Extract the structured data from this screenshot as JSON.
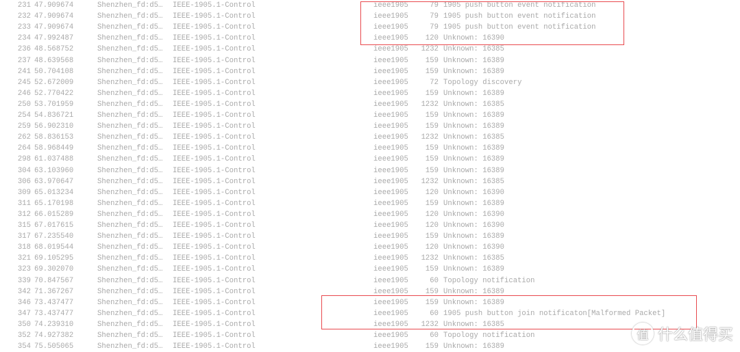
{
  "packet_list": {
    "rows": [
      [
        "231",
        "47.909674",
        "Shenzhen_fd:d5…",
        "IEEE-1905.1-Control",
        "ieee1905",
        "79",
        "1905 push button event notification"
      ],
      [
        "232",
        "47.909674",
        "Shenzhen_fd:d5…",
        "IEEE-1905.1-Control",
        "ieee1905",
        "79",
        "1905 push button event notification"
      ],
      [
        "233",
        "47.909674",
        "Shenzhen_fd:d5…",
        "IEEE-1905.1-Control",
        "ieee1905",
        "79",
        "1905 push button event notification"
      ],
      [
        "234",
        "47.992487",
        "Shenzhen_fd:d5…",
        "IEEE-1905.1-Control",
        "ieee1905",
        "120",
        "Unknown: 16390"
      ],
      [
        "236",
        "48.568752",
        "Shenzhen_fd:d5…",
        "IEEE-1905.1-Control",
        "ieee1905",
        "1232",
        "Unknown: 16385"
      ],
      [
        "237",
        "48.639568",
        "Shenzhen_fd:d5…",
        "IEEE-1905.1-Control",
        "ieee1905",
        "159",
        "Unknown: 16389"
      ],
      [
        "241",
        "50.704108",
        "Shenzhen_fd:d5…",
        "IEEE-1905.1-Control",
        "ieee1905",
        "159",
        "Unknown: 16389"
      ],
      [
        "245",
        "52.672009",
        "Shenzhen_fd:d5…",
        "IEEE-1905.1-Control",
        "ieee1905",
        "72",
        "Topology discovery"
      ],
      [
        "246",
        "52.770422",
        "Shenzhen_fd:d5…",
        "IEEE-1905.1-Control",
        "ieee1905",
        "159",
        "Unknown: 16389"
      ],
      [
        "250",
        "53.701959",
        "Shenzhen_fd:d5…",
        "IEEE-1905.1-Control",
        "ieee1905",
        "1232",
        "Unknown: 16385"
      ],
      [
        "254",
        "54.836721",
        "Shenzhen_fd:d5…",
        "IEEE-1905.1-Control",
        "ieee1905",
        "159",
        "Unknown: 16389"
      ],
      [
        "259",
        "56.902310",
        "Shenzhen_fd:d5…",
        "IEEE-1905.1-Control",
        "ieee1905",
        "159",
        "Unknown: 16389"
      ],
      [
        "262",
        "58.836153",
        "Shenzhen_fd:d5…",
        "IEEE-1905.1-Control",
        "ieee1905",
        "1232",
        "Unknown: 16385"
      ],
      [
        "264",
        "58.968449",
        "Shenzhen_fd:d5…",
        "IEEE-1905.1-Control",
        "ieee1905",
        "159",
        "Unknown: 16389"
      ],
      [
        "298",
        "61.037488",
        "Shenzhen_fd:d5…",
        "IEEE-1905.1-Control",
        "ieee1905",
        "159",
        "Unknown: 16389"
      ],
      [
        "304",
        "63.103960",
        "Shenzhen_fd:d5…",
        "IEEE-1905.1-Control",
        "ieee1905",
        "159",
        "Unknown: 16389"
      ],
      [
        "306",
        "63.970647",
        "Shenzhen_fd:d5…",
        "IEEE-1905.1-Control",
        "ieee1905",
        "1232",
        "Unknown: 16385"
      ],
      [
        "309",
        "65.013234",
        "Shenzhen_fd:d5…",
        "IEEE-1905.1-Control",
        "ieee1905",
        "120",
        "Unknown: 16390"
      ],
      [
        "311",
        "65.170198",
        "Shenzhen_fd:d5…",
        "IEEE-1905.1-Control",
        "ieee1905",
        "159",
        "Unknown: 16389"
      ],
      [
        "312",
        "66.015289",
        "Shenzhen_fd:d5…",
        "IEEE-1905.1-Control",
        "ieee1905",
        "120",
        "Unknown: 16390"
      ],
      [
        "315",
        "67.017615",
        "Shenzhen_fd:d5…",
        "IEEE-1905.1-Control",
        "ieee1905",
        "120",
        "Unknown: 16390"
      ],
      [
        "317",
        "67.235540",
        "Shenzhen_fd:d5…",
        "IEEE-1905.1-Control",
        "ieee1905",
        "159",
        "Unknown: 16389"
      ],
      [
        "318",
        "68.019544",
        "Shenzhen_fd:d5…",
        "IEEE-1905.1-Control",
        "ieee1905",
        "120",
        "Unknown: 16390"
      ],
      [
        "321",
        "69.105295",
        "Shenzhen_fd:d5…",
        "IEEE-1905.1-Control",
        "ieee1905",
        "1232",
        "Unknown: 16385"
      ],
      [
        "323",
        "69.302070",
        "Shenzhen_fd:d5…",
        "IEEE-1905.1-Control",
        "ieee1905",
        "159",
        "Unknown: 16389"
      ],
      [
        "339",
        "70.847567",
        "Shenzhen_fd:d5…",
        "IEEE-1905.1-Control",
        "ieee1905",
        "60",
        "Topology notification"
      ],
      [
        "342",
        "71.367267",
        "Shenzhen_fd:d5…",
        "IEEE-1905.1-Control",
        "ieee1905",
        "159",
        "Unknown: 16389"
      ],
      [
        "346",
        "73.437477",
        "Shenzhen_fd:d5…",
        "IEEE-1905.1-Control",
        "ieee1905",
        "159",
        "Unknown: 16389"
      ],
      [
        "347",
        "73.437477",
        "Shenzhen_fd:d5…",
        "IEEE-1905.1-Control",
        "ieee1905",
        "60",
        "1905 push button join notificaton[Malformed Packet]"
      ],
      [
        "350",
        "74.239310",
        "Shenzhen_fd:d5…",
        "IEEE-1905.1-Control",
        "ieee1905",
        "1232",
        "Unknown: 16385"
      ],
      [
        "352",
        "74.927382",
        "Shenzhen_fd:d5…",
        "IEEE-1905.1-Control",
        "ieee1905",
        "60",
        "Topology notification"
      ],
      [
        "354",
        "75.505065",
        "Shenzhen_fd:d5…",
        "IEEE-1905.1-Control",
        "ieee1905",
        "159",
        "Unknown: 16389"
      ]
    ]
  },
  "highlight_color": "#e8474c",
  "watermark": {
    "logo": "值",
    "text": "什么值得买"
  }
}
